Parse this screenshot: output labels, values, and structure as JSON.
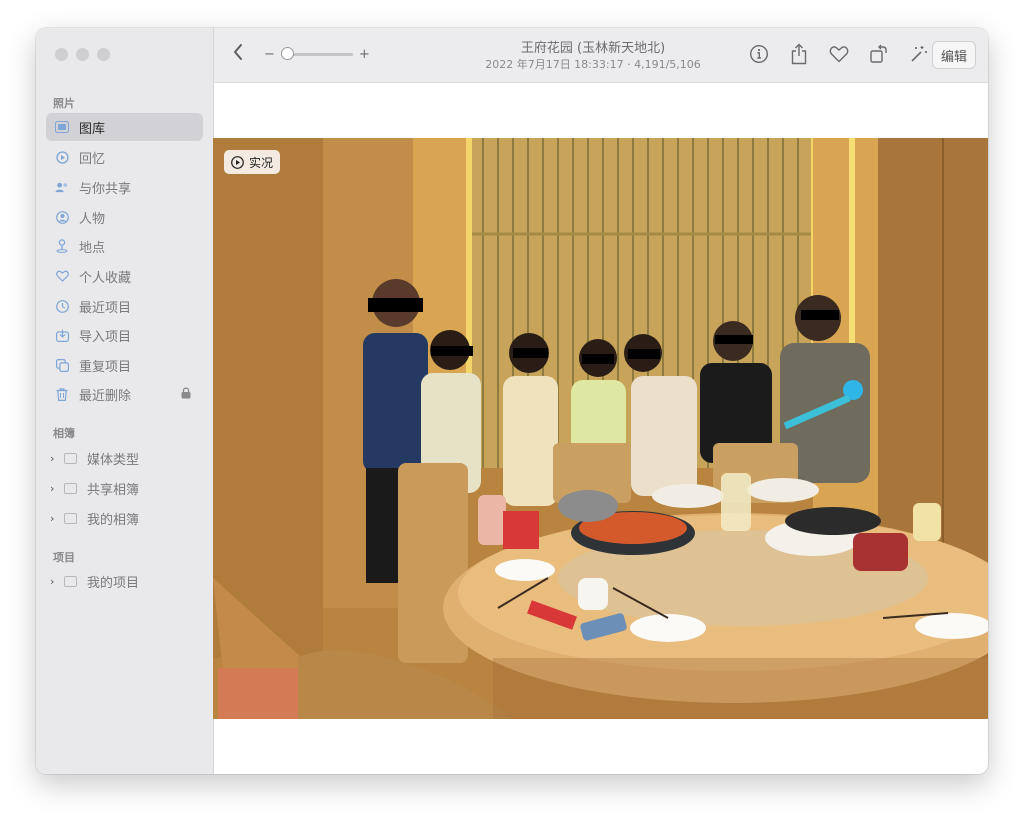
{
  "sidebar": {
    "photos_heading": "照片",
    "items": [
      {
        "label": "图库",
        "icon": "library-icon",
        "selected": true
      },
      {
        "label": "回忆",
        "icon": "memories-icon"
      },
      {
        "label": "与你共享",
        "icon": "shared-with-you-icon"
      },
      {
        "label": "人物",
        "icon": "people-icon"
      },
      {
        "label": "地点",
        "icon": "places-icon"
      },
      {
        "label": "个人收藏",
        "icon": "heart-icon"
      },
      {
        "label": "最近项目",
        "icon": "clock-icon"
      },
      {
        "label": "导入项目",
        "icon": "import-icon"
      },
      {
        "label": "重复项目",
        "icon": "duplicates-icon"
      },
      {
        "label": "最近删除",
        "icon": "trash-icon",
        "locked": true
      }
    ],
    "albums_heading": "相簿",
    "albums": [
      {
        "label": "媒体类型"
      },
      {
        "label": "共享相簿"
      },
      {
        "label": "我的相簿"
      }
    ],
    "projects_heading": "项目",
    "projects": [
      {
        "label": "我的项目"
      }
    ]
  },
  "toolbar": {
    "title": "王府花园 (玉林新天地北)",
    "subtitle": "2022 年7月17日 18:33:17 · 4,191/5,106",
    "zoom_minus": "−",
    "zoom_plus": "+",
    "edit_label": "编辑",
    "icons": [
      "info-icon",
      "share-icon",
      "heart-icon",
      "rotate-icon",
      "enhance-icon"
    ]
  },
  "photo": {
    "live_label": "实况"
  },
  "colors": {
    "accent": "#7fa6d6",
    "sidebar_bg": "#e9e9eb",
    "toolbar_bg": "#ececee"
  }
}
